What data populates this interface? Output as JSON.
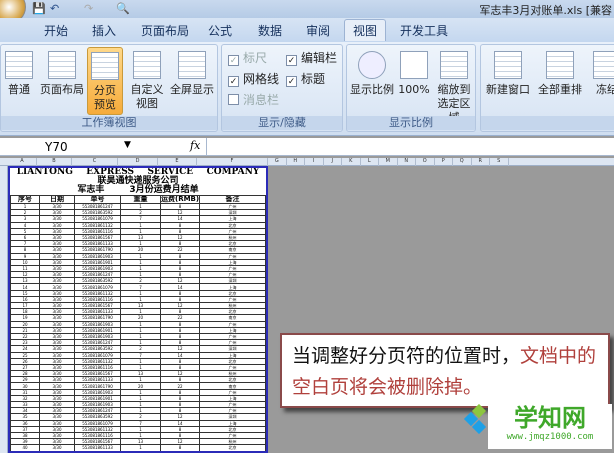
{
  "window": {
    "title": "军志丰3月对账单.xls [兼容"
  },
  "tabs": [
    "开始",
    "插入",
    "页面布局",
    "公式",
    "数据",
    "审阅",
    "视图",
    "开发工具"
  ],
  "ribbon": {
    "workbook_views": {
      "label": "工作簿视图",
      "buttons": [
        "普通",
        "页面布局",
        "分页预览",
        "自定义视图",
        "全屏显示"
      ]
    },
    "show_hide": {
      "label": "显示/隐藏",
      "items": [
        {
          "label": "标尺",
          "checked": true,
          "disabled": true
        },
        {
          "label": "编辑栏",
          "checked": true
        },
        {
          "label": "网格线",
          "checked": true
        },
        {
          "label": "标题",
          "checked": true
        },
        {
          "label": "消息栏",
          "checked": false,
          "disabled": true
        }
      ]
    },
    "zoom": {
      "label": "显示比例",
      "buttons": [
        "显示比例",
        "100%",
        "缩放到选定区域"
      ]
    },
    "window": {
      "buttons": [
        "新建窗口",
        "全部重排",
        "冻结"
      ]
    }
  },
  "formula_bar": {
    "name_box": "Y70",
    "fx": "fx",
    "value": ""
  },
  "columns": [
    "A",
    "B",
    "C",
    "D",
    "E",
    "F",
    "G",
    "H",
    "I",
    "J",
    "K",
    "L",
    "M",
    "N",
    "O",
    "P",
    "Q",
    "R",
    "S"
  ],
  "sheet": {
    "title_words": [
      "LIANTONG",
      "EXPRESS",
      "SERVICE",
      "COMPANY"
    ],
    "company": "联昊通快递服务公司",
    "subtitle_left": "军志丰",
    "subtitle_right": "3月份运费月结单",
    "headers": [
      "序号",
      "日期",
      "单号",
      "重量",
      "运费(RMB)",
      "备注"
    ],
    "rows": [
      [
        "1",
        "3/30",
        "553081861247",
        "1",
        "8",
        "广州"
      ],
      [
        "2",
        "3/30",
        "553081863592",
        "2",
        "12",
        "深圳"
      ],
      [
        "3",
        "3/30",
        "553081861079",
        "7",
        "14",
        "上海"
      ],
      [
        "4",
        "3/30",
        "553081861132",
        "1",
        "8",
        "北京"
      ],
      [
        "5",
        "3/30",
        "553081861116",
        "1",
        "8",
        "广州"
      ],
      [
        "6",
        "3/30",
        "553081861567",
        "13",
        "12",
        "杭州"
      ],
      [
        "7",
        "3/30",
        "553081861133",
        "1",
        "8",
        "北京"
      ],
      [
        "8",
        "3/30",
        "553081861790",
        "20",
        "22",
        "南京"
      ],
      [
        "9",
        "3/30",
        "553081861903",
        "1",
        "8",
        "广州"
      ],
      [
        "10",
        "3/30",
        "553081861901",
        "1",
        "8",
        "上海"
      ],
      [
        "11",
        "3/30",
        "553081861903",
        "1",
        "8",
        "广州"
      ],
      [
        "12",
        "3/30",
        "553081861247",
        "1",
        "8",
        "广州"
      ],
      [
        "13",
        "3/30",
        "553081863592",
        "2",
        "12",
        "深圳"
      ],
      [
        "14",
        "3/30",
        "553081861079",
        "7",
        "14",
        "上海"
      ],
      [
        "15",
        "3/30",
        "553081861132",
        "1",
        "8",
        "北京"
      ],
      [
        "16",
        "3/30",
        "553081861116",
        "1",
        "8",
        "广州"
      ],
      [
        "17",
        "3/30",
        "553081861567",
        "13",
        "12",
        "杭州"
      ],
      [
        "18",
        "3/30",
        "553081861133",
        "1",
        "8",
        "北京"
      ],
      [
        "19",
        "3/30",
        "553081861790",
        "20",
        "22",
        "南京"
      ],
      [
        "20",
        "3/30",
        "553081861903",
        "1",
        "8",
        "广州"
      ],
      [
        "21",
        "3/30",
        "553081861901",
        "1",
        "8",
        "上海"
      ],
      [
        "22",
        "3/30",
        "553081861903",
        "1",
        "8",
        "广州"
      ],
      [
        "23",
        "3/30",
        "553081861247",
        "1",
        "8",
        "广州"
      ],
      [
        "24",
        "3/30",
        "553081863592",
        "2",
        "12",
        "深圳"
      ],
      [
        "25",
        "3/30",
        "553081861079",
        "7",
        "14",
        "上海"
      ],
      [
        "26",
        "3/30",
        "553081861132",
        "1",
        "8",
        "北京"
      ],
      [
        "27",
        "3/30",
        "553081861116",
        "1",
        "8",
        "广州"
      ],
      [
        "28",
        "3/30",
        "553081861567",
        "13",
        "12",
        "杭州"
      ],
      [
        "29",
        "3/30",
        "553081861133",
        "1",
        "8",
        "北京"
      ],
      [
        "30",
        "3/30",
        "553081861790",
        "20",
        "22",
        "南京"
      ],
      [
        "31",
        "3/30",
        "553081861903",
        "1",
        "8",
        "广州"
      ],
      [
        "32",
        "3/30",
        "553081861901",
        "1",
        "8",
        "上海"
      ],
      [
        "33",
        "3/30",
        "553081861903",
        "1",
        "8",
        "广州"
      ],
      [
        "34",
        "3/30",
        "553081861247",
        "1",
        "8",
        "广州"
      ],
      [
        "35",
        "3/30",
        "553081863592",
        "2",
        "12",
        "深圳"
      ],
      [
        "36",
        "3/30",
        "553081861079",
        "7",
        "14",
        "上海"
      ],
      [
        "37",
        "3/30",
        "553081861132",
        "1",
        "8",
        "北京"
      ],
      [
        "38",
        "3/30",
        "553081861116",
        "1",
        "8",
        "广州"
      ],
      [
        "39",
        "3/30",
        "553081861567",
        "13",
        "12",
        "杭州"
      ],
      [
        "40",
        "3/30",
        "553081861133",
        "1",
        "8",
        "北京"
      ]
    ]
  },
  "callout": {
    "black": "当调整好分页符的位置时，",
    "red": "文档中的空白页将会被删除掉。"
  },
  "watermark": {
    "name": "学知网",
    "url": "www.jmqz1000.com"
  }
}
